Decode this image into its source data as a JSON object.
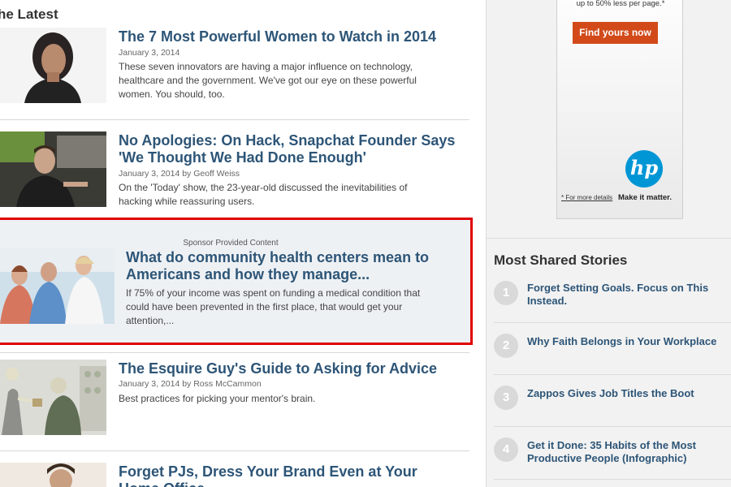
{
  "latest": {
    "section_title": "he Latest",
    "articles": [
      {
        "headline": "The 7 Most Powerful Women to Watch in 2014",
        "meta": "January 3, 2014",
        "summary_lines": [
          "These seven innovators are having a major influence on technology,",
          "healthcare and the government. We've got our eye on these powerful",
          "women. You should, too."
        ]
      },
      {
        "headline_lines": [
          "No Apologies: On Hack, Snapchat Founder Says",
          "'We Thought We Had Done Enough'"
        ],
        "meta": "January 3, 2014 by Geoff Weiss",
        "summary_lines": [
          "On the 'Today' show, the 23-year-old discussed the inevitabilities of",
          "hacking while reassuring users."
        ]
      },
      {
        "sponsor_label": "Sponsor Provided Content",
        "headline_lines": [
          "What do community health centers mean to",
          "Americans and how they manage..."
        ],
        "summary_lines": [
          "If 75% of your income was spent on funding a medical condition that",
          "could have been prevented in the first place, that would get your",
          "attention,..."
        ]
      },
      {
        "headline": "The Esquire Guy's Guide to Asking for Advice",
        "meta": "January 3, 2014 by Ross McCammon",
        "summary_lines": [
          "Best practices for picking your mentor's brain."
        ]
      },
      {
        "headline_lines": [
          "Forget PJs, Dress Your Brand Even at Your",
          "Home Office"
        ]
      }
    ]
  },
  "ad": {
    "top_text": "up to 50% less per page.*",
    "button": "Find yours now",
    "logo": "hp",
    "foot_left": "* For more details",
    "foot_right": "Make it matter."
  },
  "most_shared": {
    "title": "Most Shared Stories",
    "items": [
      {
        "num": "1",
        "lines": [
          "Forget Setting Goals. Focus on This",
          "Instead."
        ]
      },
      {
        "num": "2",
        "lines": [
          "Why Faith Belongs in Your Workplace"
        ]
      },
      {
        "num": "3",
        "lines": [
          "Zappos Gives Job Titles the Boot"
        ]
      },
      {
        "num": "4",
        "lines": [
          "Get it Done: 35 Habits of the Most",
          "Productive People (Infographic)"
        ]
      }
    ]
  },
  "colors": {
    "headline": "#2d5577",
    "sponsor_border": "#e00000",
    "ad_button": "#d24a1a",
    "hp_blue": "#0096d6"
  }
}
